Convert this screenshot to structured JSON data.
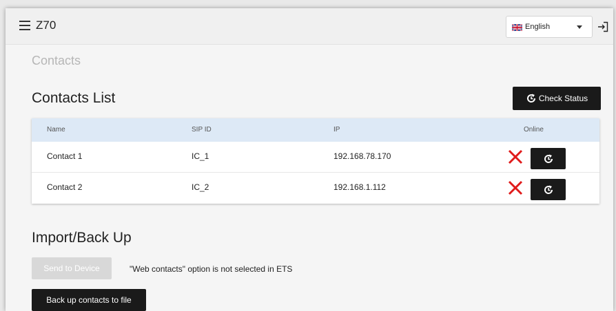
{
  "header": {
    "app_title": "Z70",
    "language": {
      "selected": "English",
      "flag": "uk-flag"
    },
    "menu_icon": "hamburger-menu-icon",
    "logout_icon": "logout-icon"
  },
  "page": {
    "title": "Contacts"
  },
  "contacts": {
    "section_title": "Contacts List",
    "check_status_label": "Check Status",
    "columns": [
      "Name",
      "SIP ID",
      "IP",
      "Online"
    ],
    "rows": [
      {
        "name": "Contact 1",
        "sip_id": "IC_1",
        "ip": "192.168.78.170",
        "online": false
      },
      {
        "name": "Contact 2",
        "sip_id": "IC_2",
        "ip": "192.168.1.112",
        "online": false
      }
    ]
  },
  "import_backup": {
    "section_title": "Import/Back Up",
    "send_label": "Send to Device",
    "note": "\"Web contacts\" option is not selected in ETS",
    "backup_label": "Back up contacts to file"
  },
  "colors": {
    "offline_x": "#e01b1b",
    "table_header": "#dde9f6",
    "dark_button": "#1a1a1a"
  }
}
